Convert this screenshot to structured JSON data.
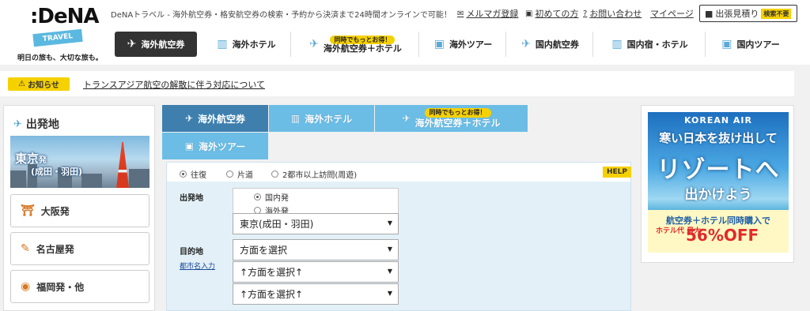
{
  "header": {
    "logo": {
      "brand": ":DeNA",
      "badge": "TRAVEL",
      "tagline": "明日の旅も、大切な旅も。"
    },
    "tagline": "DeNAトラベル - 海外航空券・格安航空券の検索・予約から決済まで24時間オンラインで可能！",
    "links": [
      {
        "icon": "mail-icon",
        "glyph": "✉",
        "label": "メルマガ登録"
      },
      {
        "icon": "book-icon",
        "glyph": "▣",
        "label": "初めての方"
      },
      {
        "icon": "question-icon",
        "glyph": "?",
        "label": "お問い合わせ"
      },
      {
        "label": "マイページ"
      }
    ],
    "estimate": {
      "label": "出張見積り",
      "badge": "検索不要"
    }
  },
  "nav": [
    {
      "label": "海外航空券",
      "icon": "airplane-icon",
      "glyph": "✈",
      "active": true
    },
    {
      "label": "海外ホテル",
      "icon": "hotel-icon",
      "glyph": "▥"
    },
    {
      "promo": "同時でもっとお得！",
      "label": "海外航空券＋ホテル",
      "icon": "airplane-hotel-icon",
      "glyph": "✈"
    },
    {
      "label": "海外ツアー",
      "icon": "suitcase-icon",
      "glyph": "▣"
    },
    {
      "label": "国内航空券",
      "icon": "domestic-airplane-icon",
      "glyph": "✈"
    },
    {
      "label": "国内宿・ホテル",
      "icon": "domestic-hotel-icon",
      "glyph": "▥"
    },
    {
      "label": "国内ツアー",
      "icon": "domestic-tour-icon",
      "glyph": "▣"
    }
  ],
  "notice": {
    "badge": "お知らせ",
    "text": "トランスアジア航空の解散に伴う対応について"
  },
  "sidebar": {
    "title": "出発地",
    "featured": {
      "city": "東京",
      "suffix": "発",
      "sub": "(成田・羽田)"
    },
    "cities": [
      {
        "label": "大阪発",
        "icon": "osaka-castle-icon",
        "glyph": "⛩"
      },
      {
        "label": "名古屋発",
        "icon": "shrimp-icon",
        "glyph": "✎"
      },
      {
        "label": "福岡発・他",
        "icon": "mentaiko-icon",
        "glyph": "◉"
      }
    ]
  },
  "search": {
    "tabs": [
      {
        "label": "海外航空券",
        "icon": "airplane-icon",
        "glyph": "✈",
        "active": true
      },
      {
        "label": "海外ホテル",
        "icon": "hotel-icon",
        "glyph": "▥"
      },
      {
        "promo": "同時でもっとお得！",
        "label": "海外航空券＋ホテル",
        "icon": "airplane-hotel-icon",
        "glyph": "✈"
      },
      {
        "label": "海外ツアー",
        "icon": "suitcase-icon",
        "glyph": "▣"
      }
    ],
    "trip_types": [
      {
        "label": "往復",
        "selected": true
      },
      {
        "label": "片道",
        "selected": false
      },
      {
        "label": "2都市以上訪問(周遊)",
        "selected": false
      }
    ],
    "help": "HELP",
    "origin": {
      "label": "出発地",
      "options": [
        {
          "label": "国内発",
          "selected": true
        },
        {
          "label": "海外発",
          "selected": false
        }
      ],
      "value": "東京(成田・羽田)"
    },
    "destination": {
      "label": "目的地",
      "city_input_link": "都市名入力",
      "values": [
        "方面を選択",
        "↑方面を選択↑",
        "↑方面を選択↑"
      ]
    }
  },
  "ad": {
    "logo": "KOREAN AIR",
    "line1": "寒い日本を抜け出して",
    "line2": "リゾートへ",
    "line3": "出かけよう",
    "line4": "航空券＋ホテル同時購入で",
    "line5": "ホテル代 最大",
    "line6": "56%OFF"
  }
}
